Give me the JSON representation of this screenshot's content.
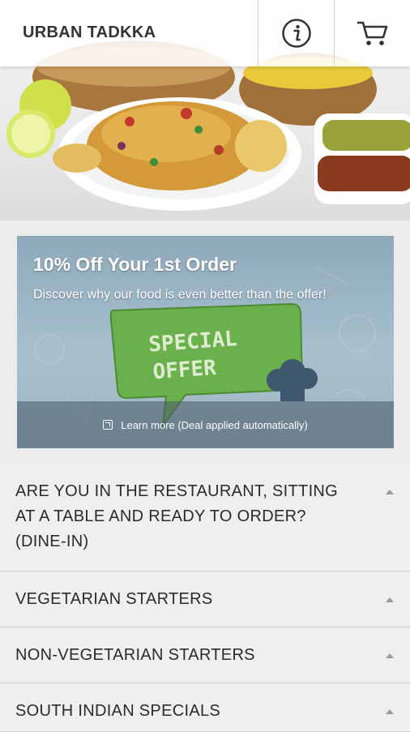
{
  "header": {
    "brand": "URBAN TADKKA",
    "info_icon": "info-icon",
    "cart_icon": "cart-icon"
  },
  "promo": {
    "title": "10% Off Your 1st Order",
    "subtitle": "Discover why our food is even better than the offer!",
    "badge_line1": "SPECIAL",
    "badge_line2": "OFFER",
    "footer": "Learn more (Deal applied automatically)",
    "badge_color": "#6ab04c"
  },
  "categories": [
    {
      "label": "ARE YOU IN THE RESTAURANT, SITTING AT A TABLE AND READY TO ORDER? (DINE-IN)"
    },
    {
      "label": "VEGETARIAN STARTERS"
    },
    {
      "label": "NON-VEGETARIAN STARTERS"
    },
    {
      "label": "SOUTH INDIAN SPECIALS"
    }
  ]
}
